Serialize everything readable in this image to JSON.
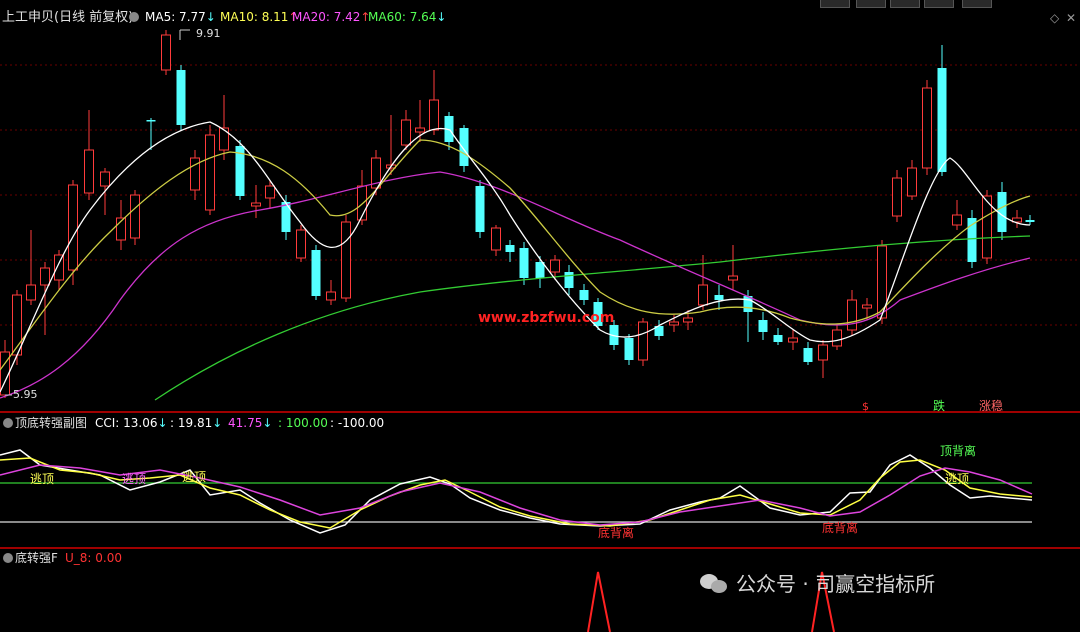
{
  "toolbar": {
    "buttons": [
      "",
      "",
      "",
      "",
      ""
    ]
  },
  "main_panel": {
    "title": "上工申贝(日线 前复权)",
    "indicators": [
      {
        "label": "MA5: 7.77",
        "arrow": "↓",
        "color": "#ffffff"
      },
      {
        "label": "MA10: 8.11",
        "arrow": "↑",
        "color": "#ffff55"
      },
      {
        "label": "MA20: 7.42",
        "arrow": "↑",
        "color": "#ff55ff"
      },
      {
        "label": "MA60: 7.64",
        "arrow": "↓",
        "color": "#55ff55"
      }
    ],
    "high_label": "9.91",
    "low_label": "5.95",
    "watermark": "www.zbzfwu.com",
    "signals": [
      {
        "text": "$",
        "color": "#ff3333"
      },
      {
        "text": "跌",
        "color": "#55ff55"
      },
      {
        "text": "涨稳",
        "color": "#ff5555"
      }
    ]
  },
  "sub_panel_1": {
    "title": "顶底转强副图",
    "indicators": [
      {
        "label": "CCI: 13.06",
        "arrow": "↓",
        "color": "#ffffff"
      },
      {
        "label": ": 19.81",
        "arrow": "↓",
        "color": "#ffffff"
      },
      {
        "label": "41.75",
        "arrow": "↓",
        "color": "#ff55ff"
      },
      {
        "label": ": 100.00",
        "arrow": "",
        "color": "#55ff55"
      },
      {
        "label": ": -100.00",
        "arrow": "",
        "color": "#ffffff"
      }
    ],
    "labels": [
      {
        "text": "逃顶",
        "color": "#ffff55"
      },
      {
        "text": "逃顶",
        "color": "#ff55ff"
      },
      {
        "text": "逃顶",
        "color": "#ffff55"
      },
      {
        "text": "顶背离",
        "color": "#55ff55"
      },
      {
        "text": "逃顶",
        "color": "#ffff55"
      },
      {
        "text": "底背离",
        "color": "#ff3333"
      },
      {
        "text": "底背离",
        "color": "#ff3333"
      }
    ]
  },
  "sub_panel_2": {
    "title": "底转强F",
    "value": "U_8: 0.00"
  },
  "footer_watermark": "公众号 · 司赢空指标所",
  "colors": {
    "up": "#ff3b3b",
    "down": "#54ffff",
    "grid": "#7a0000",
    "separator": "#a00000"
  }
}
